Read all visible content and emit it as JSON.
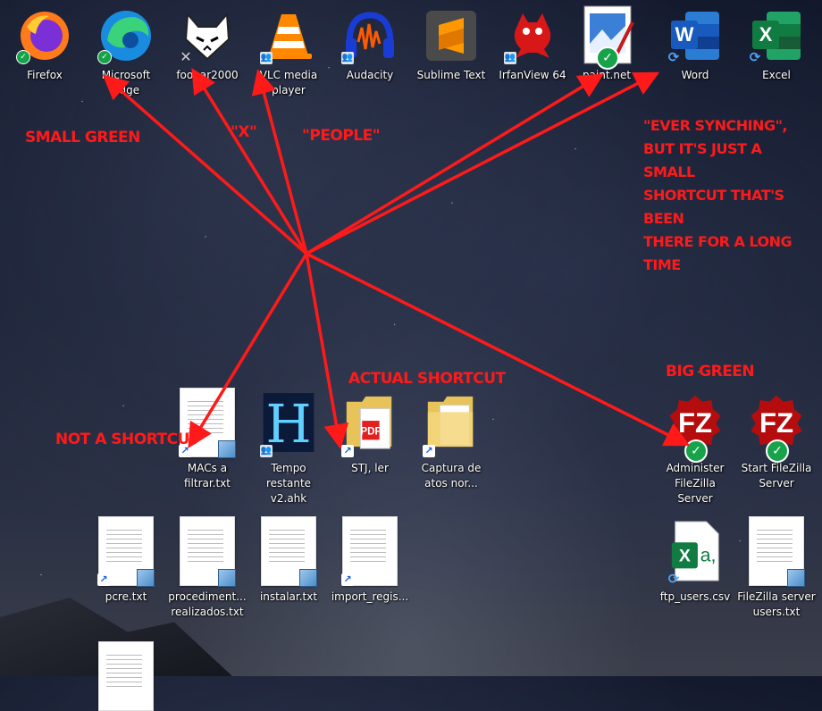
{
  "desktop": {
    "icons_top": [
      {
        "label": "Firefox",
        "overlay": "small-green"
      },
      {
        "label": "Microsoft Edge",
        "overlay": "small-green"
      },
      {
        "label": "foobar2000",
        "overlay": "x"
      },
      {
        "label": "VLC media player",
        "overlay": "people"
      },
      {
        "label": "Audacity",
        "overlay": "people"
      },
      {
        "label": "Sublime Text",
        "overlay": "none"
      },
      {
        "label": "IrfanView 64",
        "overlay": "people"
      },
      {
        "label": "paint.net",
        "overlay": "big-green"
      },
      {
        "label": "Word",
        "overlay": "sync"
      },
      {
        "label": "Excel",
        "overlay": "sync"
      }
    ],
    "icons_middle": [
      {
        "label": "MACs a filtrar.txt",
        "overlay": "shortcut"
      },
      {
        "label": "Tempo restante v2.ahk",
        "overlay": "people"
      },
      {
        "label": "STJ, ler",
        "overlay": "shortcut"
      },
      {
        "label": "Captura de atos nor...",
        "overlay": "shortcut"
      },
      {
        "label": "Administer FileZilla Server",
        "overlay": "big-green"
      },
      {
        "label": "Start FileZilla Server",
        "overlay": "big-green"
      }
    ],
    "icons_bottom": [
      {
        "label": "pcre.txt",
        "overlay": "shortcut"
      },
      {
        "label": "procediment... realizados.txt",
        "overlay": "none"
      },
      {
        "label": "instalar.txt",
        "overlay": "none"
      },
      {
        "label": "import_regis...",
        "overlay": "shortcut"
      },
      {
        "label": "ftp_users.csv",
        "overlay": "sync"
      },
      {
        "label": "FileZilla server users.txt",
        "overlay": "none"
      }
    ]
  },
  "annotations": {
    "small_green": "SMALL GREEN",
    "x": "\"X\"",
    "people": "\"PEOPLE\"",
    "ever_synching_1": "\"EVER SYNCHING\",",
    "ever_synching_2": "BUT IT'S JUST A SMALL",
    "ever_synching_3": "SHORTCUT THAT'S BEEN",
    "ever_synching_4": "THERE FOR A LONG TIME",
    "actual_shortcut": "ACTUAL SHORTCUT",
    "not_a_shortcut": "NOT A SHORTCUT",
    "big_green": "BIG GREEN"
  },
  "colors": {
    "annotation_red": "#ff1a1a",
    "badge_green": "#17a34a",
    "sync_blue": "#4aa3ff"
  }
}
